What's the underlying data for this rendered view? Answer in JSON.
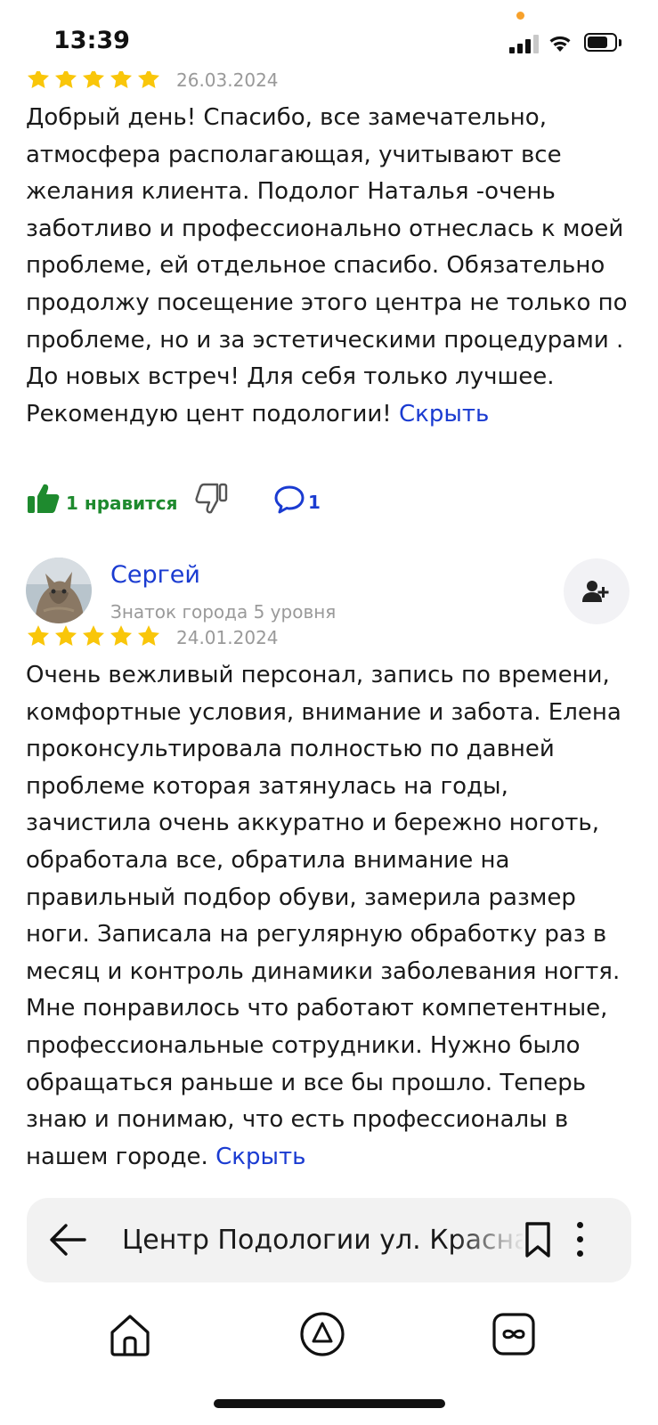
{
  "status_bar": {
    "time": "13:39"
  },
  "reviews": [
    {
      "date": "26.03.2024",
      "rating": 5,
      "text": "Добрый день! Спасибо, все замечательно, атмосфера располагающая, учитывают все желания клиента. Подолог Наталья -очень заботливо и профессионально отнеслась к моей проблеме, ей отдельное спасибо. Обязательно продолжу посещение этого центра не только по проблеме, но и за эстетическими процедурами . До новых встреч! Для себя только лучшее. Рекомендую цент подологии!",
      "hide_label": "Скрыть",
      "likes_label": "1 нравится",
      "comments_count": "1"
    },
    {
      "author": "Сергей",
      "author_level": "Знаток города 5 уровня",
      "date": "24.01.2024",
      "rating": 5,
      "text": "Очень вежливый персонал, запись по времени, комфортные условия, внимание и забота. Елена проконсультировала полностью по давней проблеме которая затянулась на годы, зачистила очень аккуратно и бережно ноготь, обработала все, обратила внимание на правильный подбор обуви, замерила размер ноги. Записала на регулярную обработку раз в месяц и контроль динамики заболевания ногтя. Мне понравилось что работают компетентные, профессиональные сотрудники. Нужно было обращаться раньше и все бы прошло. Теперь знаю и понимаю, что есть профессионалы в нашем городе.",
      "hide_label": "Скрыть"
    }
  ],
  "address_bar": {
    "title": "Центр Подологии ул. Красная"
  },
  "icons": {
    "star": "star-icon",
    "like": "thumbs-up-icon",
    "dislike": "thumbs-down-icon",
    "comment": "comment-icon",
    "subscribe": "add-user-icon",
    "back": "arrow-left-icon",
    "bookmark": "bookmark-icon",
    "more": "more-vertical-icon",
    "home": "home-icon",
    "alice": "alice-icon",
    "tabs": "tabs-icon"
  },
  "colors": {
    "star": "#f9c60a",
    "link": "#1a3bd1",
    "like": "#1e8a2e",
    "muted": "#999999"
  }
}
